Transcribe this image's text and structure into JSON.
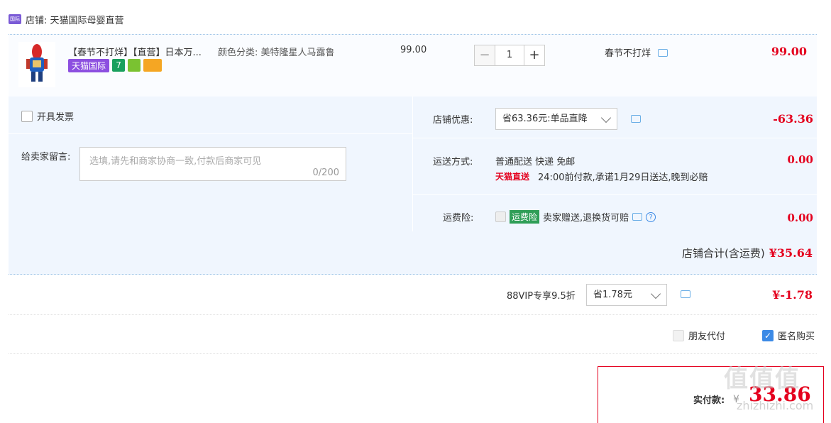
{
  "shop": {
    "icon": "tmall-global-icon",
    "icon_text": "国际",
    "label": "店铺: 天猫国际母婴直营"
  },
  "item": {
    "title": "【春节不打烊】【直营】日本万...",
    "spec": "颜色分类: 美特隆星人马露鲁",
    "badges": {
      "tmall": "天猫国际",
      "seven": "7"
    },
    "unit_price": "99.00",
    "qty": {
      "minus": "−",
      "value": "1",
      "plus": "+"
    },
    "promo_tag": "春节不打烊",
    "total": "99.00"
  },
  "options": {
    "invoice_label": "开具发票",
    "message_label": "给卖家留言:",
    "message_placeholder": "选填,请先和商家协商一致,付款后商家可见",
    "message_count": "0/200",
    "shop_discount": {
      "label": "店铺优惠:",
      "selected": "省63.36元:单品直降",
      "amount": "-63.36"
    },
    "shipping": {
      "label": "运送方式:",
      "method": "普通配送 快递 免邮",
      "express_brand": "天猫直送",
      "promise": "24:00前付款,承诺1月29日送达,晚到必赔",
      "amount": "0.00"
    },
    "insurance": {
      "label": "运费险:",
      "badge": "运费险",
      "desc": "卖家赠送,退换货可赔",
      "help": "?",
      "amount": "0.00"
    },
    "shop_total": {
      "label": "店铺合计(含运费)",
      "amount": "¥35.64"
    }
  },
  "vip": {
    "label": "88VIP专享9.5折",
    "selected": "省1.78元",
    "amount": "¥-1.78"
  },
  "pay_options": {
    "friend_pay": "朋友代付",
    "anonymous": "匿名购买",
    "check": "✓"
  },
  "final": {
    "label": "实付款:",
    "currency": "¥",
    "amount": "33.86"
  },
  "watermark": {
    "logo": "值值值",
    "site": "zhizhizhi.com"
  },
  "colors": {
    "accent_red": "#e4001e",
    "panel_bg": "#f0f6fe",
    "link_blue": "#3c8ae6"
  }
}
